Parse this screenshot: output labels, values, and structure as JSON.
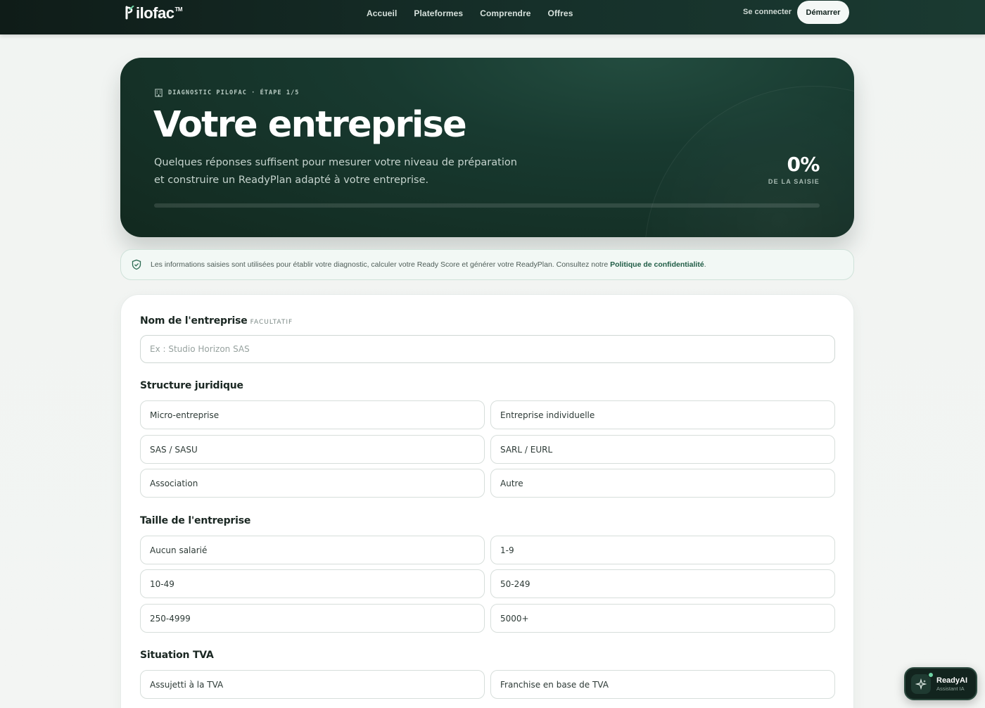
{
  "header": {
    "logo": "Pilofac",
    "logo_suffix": "ilofac",
    "logo_tm": "TM",
    "nav": [
      "Accueil",
      "Plateformes",
      "Comprendre",
      "Offres"
    ],
    "login_label": "Se connecter",
    "start_label": "Démarrer"
  },
  "hero": {
    "eyebrow": "DIAGNOSTIC PILOFAC · ÉTAPE 1/5",
    "title": "Votre entreprise",
    "subtitle": "Quelques réponses suffisent pour mesurer votre niveau de préparation et construire un ReadyPlan adapté à votre entreprise.",
    "percent": "0%",
    "percent_label": "DE LA SAISIE",
    "progress": 0
  },
  "notice": {
    "text": "Les informations saisies sont utilisées pour établir votre diagnostic, calculer votre Ready Score et générer votre ReadyPlan. Consultez notre ",
    "link": "Politique de confidentialité",
    "end": "."
  },
  "form": {
    "company_name": {
      "label": "Nom de l'entreprise",
      "optional": "FACULTATIF",
      "placeholder": "Ex : Studio Horizon SAS",
      "value": ""
    },
    "legal_structure": {
      "label": "Structure juridique",
      "options": [
        "Micro-entreprise",
        "Entreprise individuelle",
        "SAS / SASU",
        "SARL / EURL",
        "Association",
        "Autre"
      ]
    },
    "company_size": {
      "label": "Taille de l'entreprise",
      "options": [
        "Aucun salarié",
        "1-9",
        "10-49",
        "50-249",
        "250-4999",
        "5000+"
      ]
    },
    "vat_status": {
      "label": "Situation TVA",
      "options": [
        "Assujetti à la TVA",
        "Franchise en base de TVA"
      ]
    }
  },
  "assistant": {
    "title": "ReadyAI",
    "subtitle": "Assistant IA"
  },
  "colors": {
    "accent": "#1f5c45",
    "hero_bg": "#183a30",
    "progress": "#6fd3a4"
  }
}
